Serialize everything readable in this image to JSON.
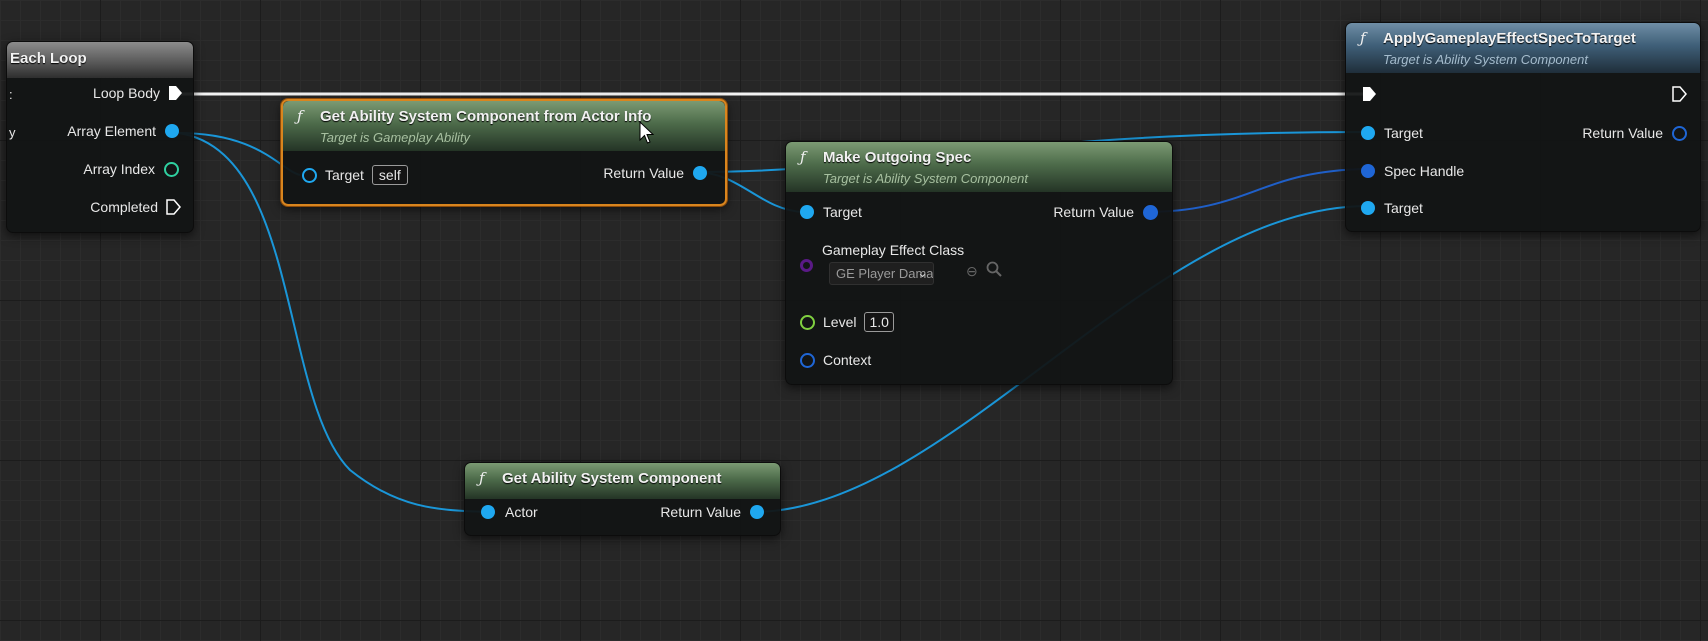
{
  "colors": {
    "object_pin": "#1fa8f0",
    "struct_pin": "#1f66d6",
    "int_pin": "#2fd0a0",
    "float_pin": "#80d040",
    "class_pin": "#5a1a86",
    "selection": "#d9851e",
    "pure_header": "#4d6b4a",
    "callable_header": "#3f5f78"
  },
  "icons": {
    "function": "ƒ",
    "dropdown": "chevron-down-icon",
    "use_selected": "arrow-left-circle-icon",
    "browse": "search-icon",
    "cursor": "mouse-cursor-icon"
  },
  "foreach_node": {
    "title": "Each Loop",
    "loop_body": "Loop Body",
    "array_element": "Array Element",
    "array_index": "Array Index",
    "completed": "Completed",
    "left_edge_glyphs": [
      ":",
      "y"
    ]
  },
  "get_asc_actor_info": {
    "fn_glyph": "ƒ",
    "title": "Get Ability System Component from Actor Info",
    "subtitle": "Target is Gameplay Ability",
    "target_label": "Target",
    "target_value": "self",
    "return_label": "Return Value"
  },
  "make_outgoing_spec": {
    "fn_glyph": "ƒ",
    "title": "Make Outgoing Spec",
    "subtitle": "Target is Ability System Component",
    "target_label": "Target",
    "return_label": "Return Value",
    "effect_class_label": "Gameplay Effect Class",
    "effect_class_value": "GE Player Dama",
    "level_label": "Level",
    "level_value": "1.0",
    "context_label": "Context"
  },
  "get_asc": {
    "fn_glyph": "ƒ",
    "title": "Get Ability System Component",
    "actor_label": "Actor",
    "return_label": "Return Value"
  },
  "apply_spec": {
    "fn_glyph": "ƒ",
    "title": "ApplyGameplayEffectSpecToTarget",
    "subtitle": "Target is Ability System Component",
    "target_label": "Target",
    "return_label": "Return Value",
    "spec_handle_label": "Spec Handle",
    "target2_label": "Target"
  }
}
